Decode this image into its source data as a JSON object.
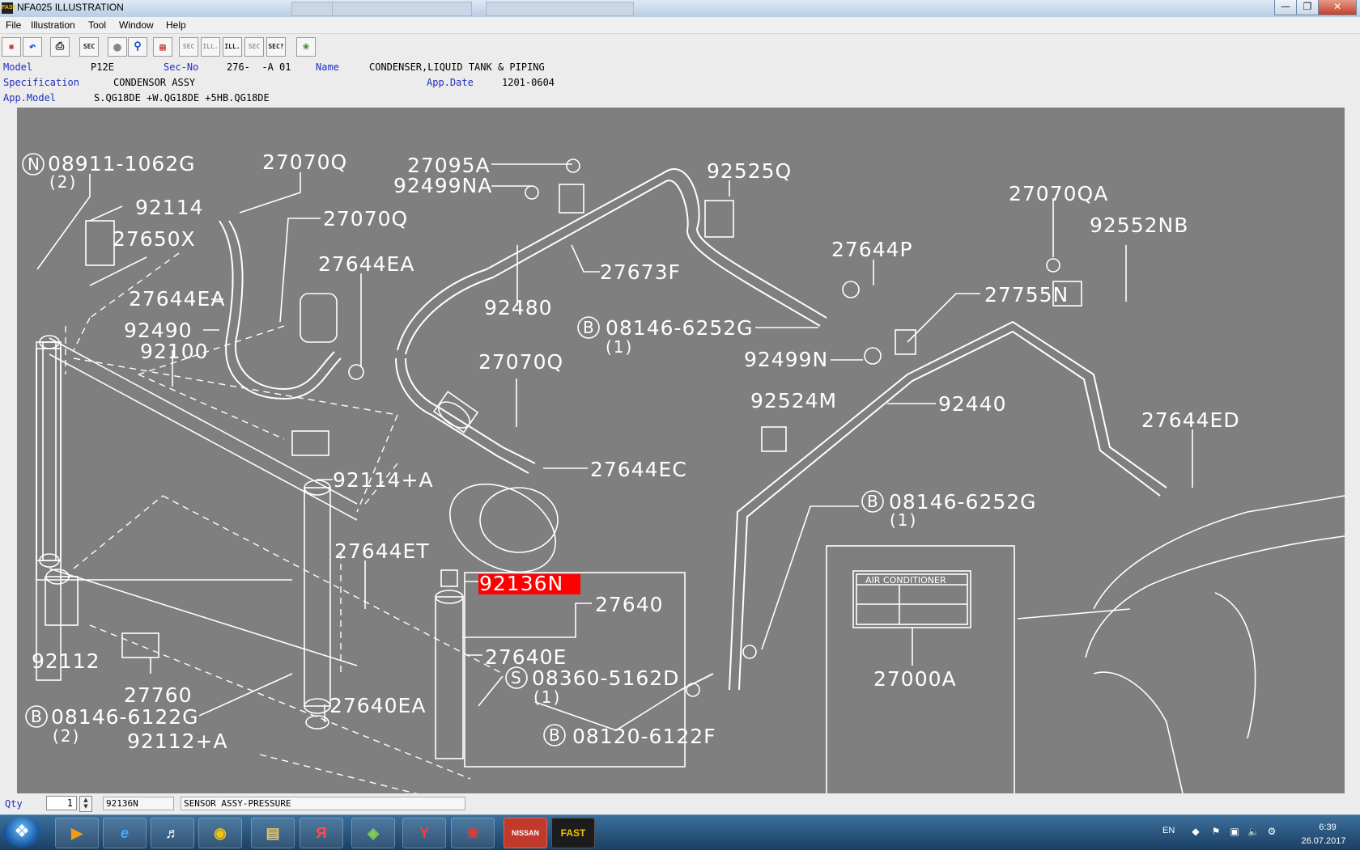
{
  "window": {
    "title": "NFA025  ILLUSTRATION"
  },
  "background_tabs": [
    "",
    "",
    ""
  ],
  "menu": [
    "File",
    "Illustration",
    "Tool",
    "Window",
    "Help"
  ],
  "toolbar": {
    "buttons": [
      "parts-icon",
      "undo-icon",
      "print-icon",
      "sec-icon",
      "record-icon",
      "zoom-icon",
      "book-icon",
      "sec-prev-icon",
      "ill-prev-icon",
      "ill-next-icon",
      "sec-next-icon",
      "sec-search-icon",
      "hint-icon"
    ],
    "sec_label": "SEC",
    "ill_label": "ILL.",
    "sec_q_label": "SEC?"
  },
  "header": {
    "model_label": "Model",
    "model_value": "P12E",
    "secno_label": "Sec-No",
    "secno_value": "276-  -A 01",
    "name_label": "Name",
    "name_value": "CONDENSER,LIQUID TANK & PIPING",
    "spec_label": "Specification",
    "spec_value": "CONDENSOR ASSY",
    "appdate_label": "App.Date",
    "appdate_value": "1201-0604",
    "appmodel_label": "App.Model",
    "appmodel_value": "S.QG18DE +W.QG18DE +5HB.QG18DE"
  },
  "diagram": {
    "parts": [
      "08911-1062G",
      "(2)",
      "27070Q",
      "27095A",
      "92499NA",
      "92525Q",
      "27070QA",
      "92552NB",
      "92114",
      "27650X",
      "27070Q",
      "27644EA",
      "27673F",
      "27644P",
      "27644EA",
      "92490",
      "92100",
      "92480",
      "08146-6252G",
      "(1)",
      "27755N",
      "92499N",
      "27070Q",
      "92440",
      "92524M",
      "27644ED",
      "27644EC",
      "92114+A",
      "08146-6252G",
      "(1)",
      "27644ET",
      "92136N",
      "27640",
      "92112",
      "27640E",
      "08360-5162D",
      "(1)",
      "27760",
      "27640EA",
      "08146-6122G",
      "(2)",
      "08120-6122F",
      "27000A",
      "AIR CONDITIONER",
      "92112+A"
    ],
    "markers": {
      "n": "N",
      "b": "B",
      "s": "S"
    },
    "highlighted_part": "92136N",
    "highlight_color": "#ff0000"
  },
  "status": {
    "qty_label": "Qty",
    "qty_value": "1",
    "part_number": "92136N",
    "part_name": "SENSOR ASSY-PRESSURE"
  },
  "taskbar": {
    "apps": [
      "media-player",
      "internet-explorer",
      "volume-app",
      "chrome",
      "explorer",
      "yandex-browser",
      "bluestacks",
      "yandex",
      "pdf-reader",
      "nissan",
      "fast"
    ],
    "nissan_label": "NISSAN",
    "fast_label": "FAST",
    "ya_label": "Я",
    "y_label": "Y",
    "language": "EN",
    "time": "6:39",
    "date": "26.07.2017"
  }
}
